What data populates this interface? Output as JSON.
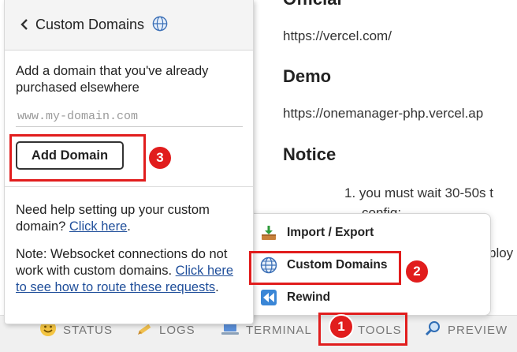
{
  "document": {
    "heading_official": "Official",
    "official_url": "https://vercel.com/",
    "heading_demo": "Demo",
    "demo_url": "https://onemanager-php.vercel.ap",
    "heading_notice": "Notice",
    "notice_item": "1. you must wait 30-50s t",
    "notice_partial1": "config;",
    "notice_partial2": "ploy"
  },
  "panel": {
    "title": "Custom Domains",
    "description": "Add a domain that you've already purchased elsewhere",
    "input_placeholder": "www.my-domain.com",
    "add_button": "Add Domain",
    "help_text": "Need help setting up your custom domain?",
    "help_link": "Click here",
    "help_end": ".",
    "note_text": "Note: Websocket connections do not work with custom domains.",
    "note_link": "Click here to see how to route these requests",
    "note_end": "."
  },
  "menu": {
    "items": [
      {
        "label": "Import / Export",
        "icon": "import-export-icon"
      },
      {
        "label": "Custom Domains",
        "icon": "globe-icon"
      },
      {
        "label": "Rewind",
        "icon": "rewind-icon"
      }
    ]
  },
  "bottombar": {
    "tabs": [
      {
        "label": "STATUS",
        "icon": "smiley-icon"
      },
      {
        "label": "LOGS",
        "icon": "pencil-icon"
      },
      {
        "label": "TERMINAL",
        "icon": "laptop-icon"
      },
      {
        "label": "TOOLS",
        "icon": "tools-icon"
      },
      {
        "label": "PREVIEW",
        "icon": "magnifier-icon"
      }
    ]
  },
  "annotations": {
    "step1": "1",
    "step2": "2",
    "step3": "3",
    "color": "#e11d1d"
  }
}
